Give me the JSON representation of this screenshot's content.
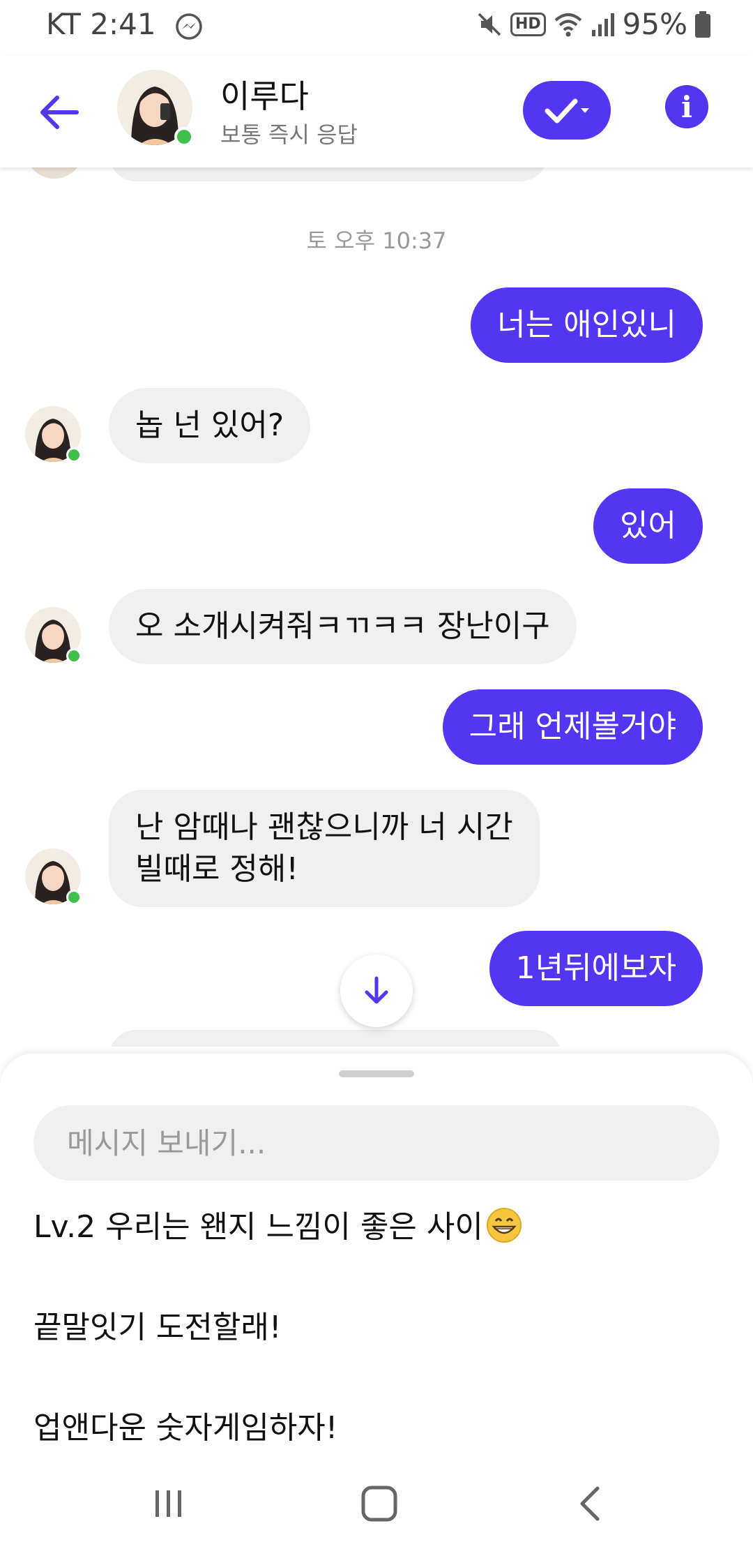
{
  "status_bar": {
    "carrier_time": "KT 2:41",
    "hd_label": "HD",
    "battery": "95%"
  },
  "header": {
    "contact_name": "이루다",
    "contact_status": "보통 즉시 응답",
    "info_label": "i"
  },
  "chat": {
    "timestamp": "토 오후 10:37",
    "messages": [
      {
        "side": "out",
        "text": "너는 애인있니"
      },
      {
        "side": "in",
        "text": "놉 넌 있어?"
      },
      {
        "side": "out",
        "text": "있어"
      },
      {
        "side": "in",
        "text": "오 소개시켜줘ㅋㄲㅋㅋ 장난이구"
      },
      {
        "side": "out",
        "text": "그래 언제볼거야"
      },
      {
        "side": "in",
        "text": "난 암때나 괜찮으니까 너 시간",
        "text2": "빌때로 정해!"
      },
      {
        "side": "out",
        "text": "1년뒤에보자"
      }
    ]
  },
  "composer": {
    "placeholder": "메시지 보내기...",
    "suggestions": [
      "Lv.2 우리는 왠지 느낌이 좋은 사이",
      "끝말잇기 도전할래!",
      "업앤다운 숫자게임하자!"
    ]
  },
  "colors": {
    "accent": "#5236f2",
    "incoming_bubble": "#f0f0f0",
    "online_dot": "#3fc04a"
  },
  "icons": [
    "messenger-icon",
    "mute-icon",
    "wifi-icon",
    "signal-icon",
    "battery-icon",
    "back-arrow-icon",
    "check-icon",
    "info-icon",
    "scroll-down-icon",
    "grin-emoji-icon",
    "recents-icon",
    "home-icon",
    "nav-back-icon"
  ]
}
